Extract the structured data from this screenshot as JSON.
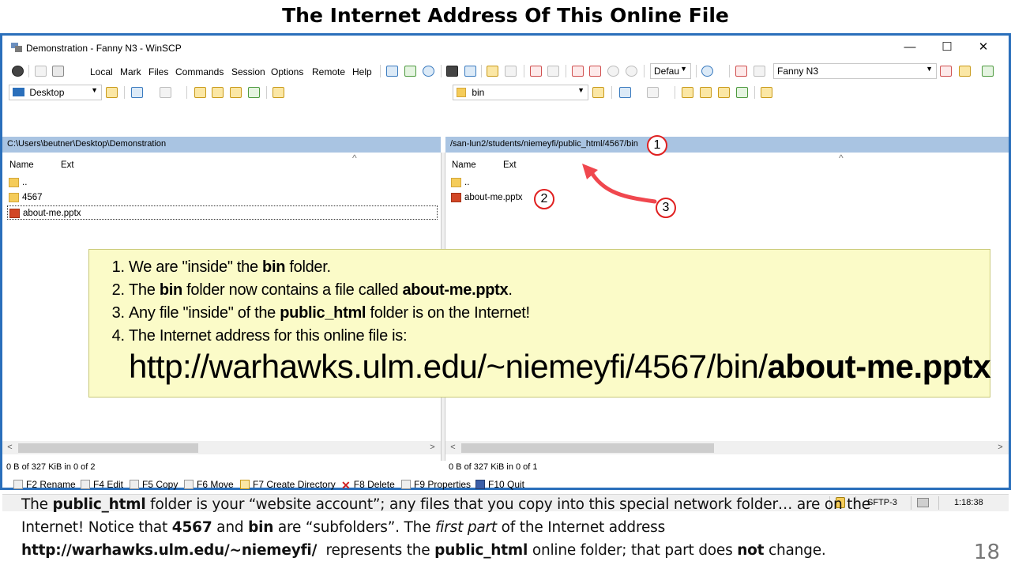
{
  "slide": {
    "title": "The Internet Address Of This Online File",
    "page_number": "18",
    "footer": {
      "p1_a": "The ",
      "p1_b": "public_html",
      "p1_c": " folder is your “website account”; any files that you copy into this special network folder… are on the",
      "p2_a": "Internet! Notice that ",
      "p2_b": "4567",
      "p2_c": " and ",
      "p2_d": "bin",
      "p2_e": " are “subfolders”. The ",
      "p2_f": "first part",
      "p2_g": " of the Internet address",
      "p3_a": "http://warhawks.ulm.edu/~niemeyfi/",
      "p3_b": "  represents the ",
      "p3_c": "public_html",
      "p3_d": " online folder; that part does ",
      "p3_e": "not",
      "p3_f": " change."
    }
  },
  "window": {
    "title": "Demonstration - Fanny N3 - WinSCP",
    "controls": {
      "minimize": "—",
      "maximize": "☐",
      "close": "✕"
    }
  },
  "menu": [
    "Local",
    "Mark",
    "Files",
    "Commands",
    "Session",
    "Options",
    "Remote",
    "Help"
  ],
  "toolbar": {
    "transfer_settings": "Defau",
    "session_combo": "Fanny N3",
    "local_location": "Desktop",
    "remote_location": "bin"
  },
  "local_panel": {
    "path": "C:\\Users\\beutner\\Desktop\\Demonstration",
    "columns": {
      "name": "Name",
      "ext": "Ext"
    },
    "files": [
      {
        "name": "..",
        "type": "up"
      },
      {
        "name": "4567",
        "type": "folder"
      },
      {
        "name": "about-me.pptx",
        "type": "pptx"
      }
    ],
    "status": "0 B of 327 KiB in 0 of 2"
  },
  "remote_panel": {
    "path": "/san-lun2/students/niemeyfi/public_html/4567/bin",
    "columns": {
      "name": "Name",
      "ext": "Ext"
    },
    "files": [
      {
        "name": "..",
        "type": "up"
      },
      {
        "name": "about-me.pptx",
        "type": "pptx"
      }
    ],
    "status": "0 B of 327 KiB in 0 of 1"
  },
  "function_keys": [
    {
      "label": "F2 Rename"
    },
    {
      "label": "F4 Edit"
    },
    {
      "label": "F5 Copy"
    },
    {
      "label": "F6 Move"
    },
    {
      "label": "F7 Create Directory"
    },
    {
      "label": "F8 Delete"
    },
    {
      "label": "F9 Properties"
    },
    {
      "label": "F10 Quit"
    }
  ],
  "statusbar": {
    "protocol": "SFTP-3",
    "time": "1:18:38"
  },
  "callout": {
    "items": [
      {
        "a": "We are \"inside\" the ",
        "b": "bin",
        "c": " folder."
      },
      {
        "a": "The ",
        "b": "bin",
        "c": " folder now contains a file called  ",
        "d": "about-me.pptx",
        "e": "."
      },
      {
        "a": "Any file \"inside\" of the ",
        "b": "public_html",
        "c": " folder is on the Internet!"
      },
      {
        "a": "The Internet address for this online file is:"
      }
    ],
    "url_prefix": "http://warhawks.ulm.edu/~niemeyfi/4567/bin/",
    "url_file": "about-me.pptx"
  },
  "badges": [
    "1",
    "2",
    "3"
  ],
  "colors": {
    "frame": "#2a6fbb",
    "path_bar": "#a9c4e2",
    "callout_bg": "#fbfbc8",
    "arrow": "#f0474e"
  }
}
